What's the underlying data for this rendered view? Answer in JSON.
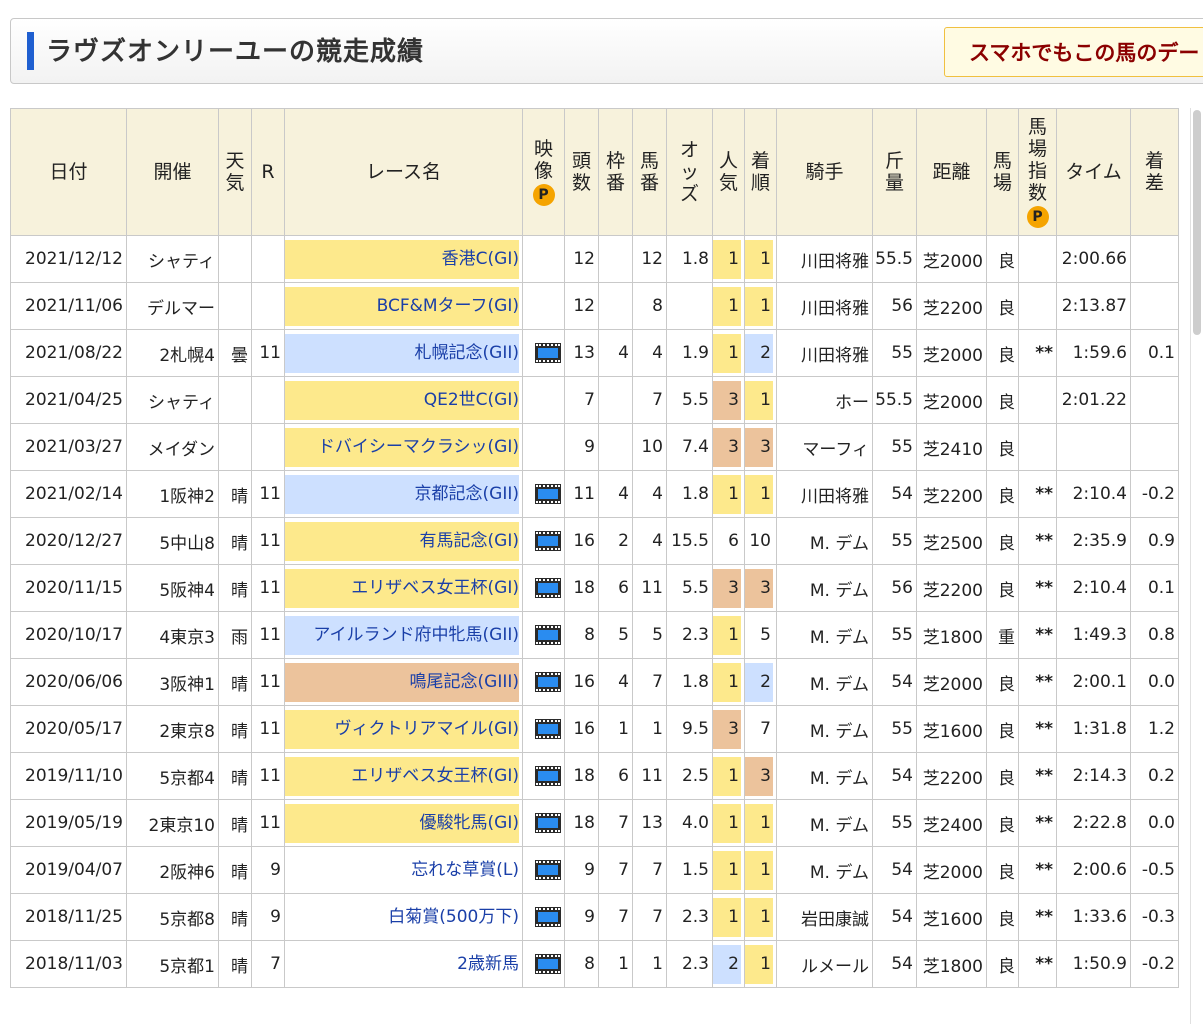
{
  "page": {
    "title": "ラヴズオンリーユーの競走成績",
    "promo_text": "スマホでもこの馬のデー"
  },
  "table": {
    "headers": {
      "date": "日付",
      "venue": "開催",
      "weather": "天気",
      "round": "R",
      "race_name": "レース名",
      "video": "映像",
      "heads": "頭数",
      "frame": "枠番",
      "horse_no": "馬番",
      "odds": "オッズ",
      "popularity": "人気",
      "finish": "着順",
      "jockey": "騎手",
      "weight": "斤量",
      "distance": "距離",
      "track": "馬場",
      "track_index": "馬場指数",
      "time": "タイム",
      "margin": "着差",
      "premium_badge": "P"
    },
    "rows": [
      {
        "date": "2021/12/12",
        "venue": "シャティ",
        "weather": "",
        "round": "",
        "race": "香港C(GI)",
        "grade": "gi",
        "video": false,
        "heads": "12",
        "frame": "",
        "horse_no": "12",
        "odds": "1.8",
        "pop": "1",
        "pop_class": "r1",
        "finish": "1",
        "finish_class": "r1",
        "jockey": "川田将雅",
        "weight": "55.5",
        "distance": "芝2000",
        "track": "良",
        "index": "",
        "time": "2:00.66",
        "margin": ""
      },
      {
        "date": "2021/11/06",
        "venue": "デルマー",
        "weather": "",
        "round": "",
        "race": "BCF&Mターフ(GI)",
        "grade": "gi",
        "video": false,
        "heads": "12",
        "frame": "",
        "horse_no": "8",
        "odds": "",
        "pop": "1",
        "pop_class": "r1",
        "finish": "1",
        "finish_class": "r1",
        "jockey": "川田将雅",
        "weight": "56",
        "distance": "芝2200",
        "track": "良",
        "index": "",
        "time": "2:13.87",
        "margin": ""
      },
      {
        "date": "2021/08/22",
        "venue": "2札幌4",
        "weather": "曇",
        "round": "11",
        "race": "札幌記念(GII)",
        "grade": "gii",
        "video": true,
        "heads": "13",
        "frame": "4",
        "horse_no": "4",
        "odds": "1.9",
        "pop": "1",
        "pop_class": "r1",
        "finish": "2",
        "finish_class": "r2",
        "jockey": "川田将雅",
        "weight": "55",
        "distance": "芝2000",
        "track": "良",
        "index": "**",
        "time": "1:59.6",
        "margin": "0.1"
      },
      {
        "date": "2021/04/25",
        "venue": "シャティ",
        "weather": "",
        "round": "",
        "race": "QE2世C(GI)",
        "grade": "gi",
        "video": false,
        "heads": "7",
        "frame": "",
        "horse_no": "7",
        "odds": "5.5",
        "pop": "3",
        "pop_class": "r3",
        "finish": "1",
        "finish_class": "r1",
        "jockey": "ホー",
        "weight": "55.5",
        "distance": "芝2000",
        "track": "良",
        "index": "",
        "time": "2:01.22",
        "margin": ""
      },
      {
        "date": "2021/03/27",
        "venue": "メイダン",
        "weather": "",
        "round": "",
        "race": "ドバイシーマクラシッ(GI)",
        "grade": "gi",
        "video": false,
        "heads": "9",
        "frame": "",
        "horse_no": "10",
        "odds": "7.4",
        "pop": "3",
        "pop_class": "r3",
        "finish": "3",
        "finish_class": "r3",
        "jockey": "マーフィ",
        "weight": "55",
        "distance": "芝2410",
        "track": "良",
        "index": "",
        "time": "",
        "margin": ""
      },
      {
        "date": "2021/02/14",
        "venue": "1阪神2",
        "weather": "晴",
        "round": "11",
        "race": "京都記念(GII)",
        "grade": "gii",
        "video": true,
        "heads": "11",
        "frame": "4",
        "horse_no": "4",
        "odds": "1.8",
        "pop": "1",
        "pop_class": "r1",
        "finish": "1",
        "finish_class": "r1",
        "jockey": "川田将雅",
        "weight": "54",
        "distance": "芝2200",
        "track": "良",
        "index": "**",
        "time": "2:10.4",
        "margin": "-0.2"
      },
      {
        "date": "2020/12/27",
        "venue": "5中山8",
        "weather": "晴",
        "round": "11",
        "race": "有馬記念(GI)",
        "grade": "gi",
        "video": true,
        "heads": "16",
        "frame": "2",
        "horse_no": "4",
        "odds": "15.5",
        "pop": "6",
        "pop_class": "",
        "finish": "10",
        "finish_class": "",
        "jockey": "M. デム",
        "weight": "55",
        "distance": "芝2500",
        "track": "良",
        "index": "**",
        "time": "2:35.9",
        "margin": "0.9"
      },
      {
        "date": "2020/11/15",
        "venue": "5阪神4",
        "weather": "晴",
        "round": "11",
        "race": "エリザベス女王杯(GI)",
        "grade": "gi",
        "video": true,
        "heads": "18",
        "frame": "6",
        "horse_no": "11",
        "odds": "5.5",
        "pop": "3",
        "pop_class": "r3",
        "finish": "3",
        "finish_class": "r3",
        "jockey": "M. デム",
        "weight": "56",
        "distance": "芝2200",
        "track": "良",
        "index": "**",
        "time": "2:10.4",
        "margin": "0.1"
      },
      {
        "date": "2020/10/17",
        "venue": "4東京3",
        "weather": "雨",
        "round": "11",
        "race": "アイルランド府中牝馬(GII)",
        "grade": "gii",
        "video": true,
        "heads": "8",
        "frame": "5",
        "horse_no": "5",
        "odds": "2.3",
        "pop": "1",
        "pop_class": "r1",
        "finish": "5",
        "finish_class": "",
        "jockey": "M. デム",
        "weight": "55",
        "distance": "芝1800",
        "track": "重",
        "index": "**",
        "time": "1:49.3",
        "margin": "0.8"
      },
      {
        "date": "2020/06/06",
        "venue": "3阪神1",
        "weather": "晴",
        "round": "11",
        "race": "鳴尾記念(GIII)",
        "grade": "giii",
        "video": true,
        "heads": "16",
        "frame": "4",
        "horse_no": "7",
        "odds": "1.8",
        "pop": "1",
        "pop_class": "r1",
        "finish": "2",
        "finish_class": "r2",
        "jockey": "M. デム",
        "weight": "54",
        "distance": "芝2000",
        "track": "良",
        "index": "**",
        "time": "2:00.1",
        "margin": "0.0"
      },
      {
        "date": "2020/05/17",
        "venue": "2東京8",
        "weather": "晴",
        "round": "11",
        "race": "ヴィクトリアマイル(GI)",
        "grade": "gi",
        "video": true,
        "heads": "16",
        "frame": "1",
        "horse_no": "1",
        "odds": "9.5",
        "pop": "3",
        "pop_class": "r3",
        "finish": "7",
        "finish_class": "",
        "jockey": "M. デム",
        "weight": "55",
        "distance": "芝1600",
        "track": "良",
        "index": "**",
        "time": "1:31.8",
        "margin": "1.2"
      },
      {
        "date": "2019/11/10",
        "venue": "5京都4",
        "weather": "晴",
        "round": "11",
        "race": "エリザベス女王杯(GI)",
        "grade": "gi",
        "video": true,
        "heads": "18",
        "frame": "6",
        "horse_no": "11",
        "odds": "2.5",
        "pop": "1",
        "pop_class": "r1",
        "finish": "3",
        "finish_class": "r3",
        "jockey": "M. デム",
        "weight": "54",
        "distance": "芝2200",
        "track": "良",
        "index": "**",
        "time": "2:14.3",
        "margin": "0.2"
      },
      {
        "date": "2019/05/19",
        "venue": "2東京10",
        "weather": "晴",
        "round": "11",
        "race": "優駿牝馬(GI)",
        "grade": "gi",
        "video": true,
        "heads": "18",
        "frame": "7",
        "horse_no": "13",
        "odds": "4.0",
        "pop": "1",
        "pop_class": "r1",
        "finish": "1",
        "finish_class": "r1",
        "jockey": "M. デム",
        "weight": "55",
        "distance": "芝2400",
        "track": "良",
        "index": "**",
        "time": "2:22.8",
        "margin": "0.0"
      },
      {
        "date": "2019/04/07",
        "venue": "2阪神6",
        "weather": "晴",
        "round": "9",
        "race": "忘れな草賞(L)",
        "grade": "",
        "video": true,
        "heads": "9",
        "frame": "7",
        "horse_no": "7",
        "odds": "1.5",
        "pop": "1",
        "pop_class": "r1",
        "finish": "1",
        "finish_class": "r1",
        "jockey": "M. デム",
        "weight": "54",
        "distance": "芝2000",
        "track": "良",
        "index": "**",
        "time": "2:00.6",
        "margin": "-0.5"
      },
      {
        "date": "2018/11/25",
        "venue": "5京都8",
        "weather": "晴",
        "round": "9",
        "race": "白菊賞(500万下)",
        "grade": "",
        "video": true,
        "heads": "9",
        "frame": "7",
        "horse_no": "7",
        "odds": "2.3",
        "pop": "1",
        "pop_class": "r1",
        "finish": "1",
        "finish_class": "r1",
        "jockey": "岩田康誠",
        "weight": "54",
        "distance": "芝1600",
        "track": "良",
        "index": "**",
        "time": "1:33.6",
        "margin": "-0.3"
      },
      {
        "date": "2018/11/03",
        "venue": "5京都1",
        "weather": "晴",
        "round": "7",
        "race": "2歳新馬",
        "grade": "",
        "video": true,
        "heads": "8",
        "frame": "1",
        "horse_no": "1",
        "odds": "2.3",
        "pop": "2",
        "pop_class": "r2",
        "finish": "1",
        "finish_class": "r1",
        "jockey": "ルメール",
        "weight": "54",
        "distance": "芝1800",
        "track": "良",
        "index": "**",
        "time": "1:50.9",
        "margin": "-0.2"
      }
    ]
  }
}
